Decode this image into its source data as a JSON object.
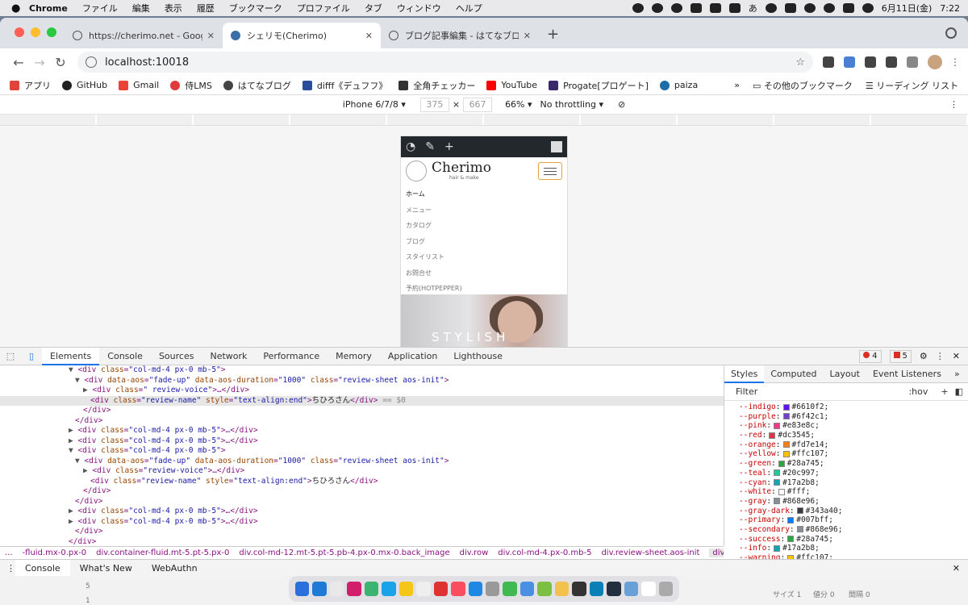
{
  "menubar": {
    "app": "Chrome",
    "items": [
      "ファイル",
      "編集",
      "表示",
      "履歴",
      "ブックマーク",
      "プロファイル",
      "タブ",
      "ウィンドウ",
      "ヘルプ"
    ],
    "date": "6月11日(金)",
    "time": "7:22",
    "ime": "あ"
  },
  "tabs": [
    {
      "title": "https://cherimo.net - Google 検索"
    },
    {
      "title": "シェリモ(Cherimo)"
    },
    {
      "title": "ブログ記事編集 - はてなブログ"
    }
  ],
  "url": "localhost:10018",
  "bookmarks": [
    {
      "label": "アプリ",
      "color": "#e0443b"
    },
    {
      "label": "GitHub",
      "color": "#222"
    },
    {
      "label": "Gmail",
      "color": "#ea4335"
    },
    {
      "label": "侍LMS",
      "color": "#e03a3a"
    },
    {
      "label": "はてなブログ",
      "color": "#444"
    },
    {
      "label": "difff《デュフフ》",
      "color": "#2a4d9b"
    },
    {
      "label": "全角チェッカー",
      "color": "#333"
    },
    {
      "label": "YouTube",
      "color": "#ff0000"
    },
    {
      "label": "Progate[プロゲート]",
      "color": "#3b2a6b"
    },
    {
      "label": "paiza",
      "color": "#1b6ea8"
    }
  ],
  "bookmarks_right": {
    "more": "»",
    "other": "その他のブックマーク",
    "reading": "リーディング リスト"
  },
  "device": {
    "name": "iPhone 6/7/8 ▾",
    "width": "375",
    "height": "667",
    "zoom": "66% ▾",
    "throttle": "No throttling ▾"
  },
  "site": {
    "name": "Cherimo",
    "sub": "hair & make",
    "nav": [
      "ホーム",
      "メニュー",
      "カタログ",
      "ブログ",
      "スタイリスト",
      "お問合せ",
      "予約(HOTPEPPER)"
    ],
    "hero": "STYLISH"
  },
  "devtools": {
    "tabs": [
      "Elements",
      "Console",
      "Sources",
      "Network",
      "Performance",
      "Memory",
      "Application",
      "Lighthouse"
    ],
    "errors": "4",
    "warnings": "5"
  },
  "dom": [
    {
      "indent": 85,
      "tri": "▼",
      "a": "<div ",
      "attrs": [
        [
          "class",
          "\"col-md-4 px-0 mb-5\""
        ]
      ],
      "b": ">"
    },
    {
      "indent": 93,
      "tri": "▼",
      "a": "<div ",
      "attrs": [
        [
          "data-aos",
          "\"fade-up\""
        ],
        [
          "data-aos-duration",
          "\"1000\""
        ],
        [
          "class",
          "\"review-sheet aos-init\""
        ]
      ],
      "b": ">"
    },
    {
      "indent": 103,
      "tri": "▶",
      "a": "<div ",
      "attrs": [
        [
          "class",
          "\" review-voice\""
        ]
      ],
      "b": ">…</div>"
    },
    {
      "indent": 112,
      "tri": "",
      "a": "<div ",
      "attrs": [
        [
          "class",
          "\"review-name\""
        ],
        [
          "style",
          "\"text-align:end\""
        ]
      ],
      "b": ">",
      "text": "ちひろさん",
      "c": "</div>",
      "suffix": " == $0",
      "sel": true
    },
    {
      "indent": 103,
      "tri": "",
      "a": "</div>",
      "attrs": [],
      "b": ""
    },
    {
      "indent": 93,
      "tri": "",
      "a": "</div>",
      "attrs": [],
      "b": ""
    },
    {
      "indent": 85,
      "tri": "▶",
      "a": "<div ",
      "attrs": [
        [
          "class",
          "\"col-md-4  px-0 mb-5\""
        ]
      ],
      "b": ">…</div>"
    },
    {
      "indent": 85,
      "tri": "▶",
      "a": "<div ",
      "attrs": [
        [
          "class",
          "\"col-md-4 px-0 mb-5\""
        ]
      ],
      "b": ">…</div>"
    },
    {
      "indent": 85,
      "tri": "▼",
      "a": "<div ",
      "attrs": [
        [
          "class",
          "\"col-md-4  px-0 mb-5\""
        ]
      ],
      "b": ">"
    },
    {
      "indent": 93,
      "tri": "▼",
      "a": "<div ",
      "attrs": [
        [
          "data-aos",
          "\"fade-up\""
        ],
        [
          "data-aos-duration",
          "\"1000\""
        ],
        [
          "class",
          "\"review-sheet aos-init\""
        ]
      ],
      "b": ">"
    },
    {
      "indent": 103,
      "tri": "▶",
      "a": "<div ",
      "attrs": [
        [
          "class",
          "\"review-voice\""
        ]
      ],
      "b": ">…</div>"
    },
    {
      "indent": 112,
      "tri": "",
      "a": "<div ",
      "attrs": [
        [
          "class",
          "\"review-name\""
        ],
        [
          "style",
          "\"text-align:end\""
        ]
      ],
      "b": ">",
      "text": "ちひろさん",
      "c": "</div>"
    },
    {
      "indent": 103,
      "tri": "",
      "a": "</div>",
      "attrs": [],
      "b": ""
    },
    {
      "indent": 93,
      "tri": "",
      "a": "</div>",
      "attrs": [],
      "b": ""
    },
    {
      "indent": 85,
      "tri": "▶",
      "a": "<div ",
      "attrs": [
        [
          "class",
          "\"col-md-4  px-0 mb-5\""
        ]
      ],
      "b": ">…</div>"
    },
    {
      "indent": 85,
      "tri": "▶",
      "a": "<div ",
      "attrs": [
        [
          "class",
          "\"col-md-4 px-0  mb-5\""
        ]
      ],
      "b": ">…</div>"
    },
    {
      "indent": 93,
      "tri": "",
      "a": "</div>",
      "attrs": [],
      "b": ""
    },
    {
      "indent": 85,
      "tri": "",
      "a": "</div>",
      "attrs": [],
      "b": ""
    }
  ],
  "styles": {
    "tabs": [
      "Styles",
      "Computed",
      "Layout",
      "Event Listeners",
      "»"
    ],
    "filter": "Filter",
    "hov": ":hov",
    ".cls": ".cls",
    "vars": [
      [
        "--indigo",
        "#6610f2"
      ],
      [
        "--purple",
        "#6f42c1"
      ],
      [
        "--pink",
        "#e83e8c"
      ],
      [
        "--red",
        "#dc3545"
      ],
      [
        "--orange",
        "#fd7e14"
      ],
      [
        "--yellow",
        "#ffc107"
      ],
      [
        "--green",
        "#28a745"
      ],
      [
        "--teal",
        "#20c997"
      ],
      [
        "--cyan",
        "#17a2b8"
      ],
      [
        "--white",
        "#fff"
      ],
      [
        "--gray",
        "#868e96"
      ],
      [
        "--gray-dark",
        "#343a40"
      ],
      [
        "--primary",
        "#007bff"
      ],
      [
        "--secondary",
        "#868e96"
      ],
      [
        "--success",
        "#28a745"
      ],
      [
        "--info",
        "#17a2b8"
      ],
      [
        "--warning",
        "#ffc107"
      ]
    ]
  },
  "breadcrumbs": [
    "...",
    "-fluid.mx-0.px-0",
    "div.container-fluid.mt-5.pt-5.px-0",
    "div.col-md-12.mt-5.pt-5.pb-4.px-0.mx-0.back_image",
    "div.row",
    "div.col-md-4.px-0.mb-5",
    "div.review-sheet.aos-init",
    "div.review-name",
    "..."
  ],
  "drawer": {
    "tabs": [
      "Console",
      "What's New",
      "WebAuthn"
    ]
  },
  "background": {
    "rows": [
      "5",
      "1"
    ],
    "right": [
      "サイズ 1",
      "値分 0",
      "間隔 0"
    ]
  },
  "dock": [
    "#2a6fdb",
    "#1f7ad6",
    "#e8e8e8",
    "#d21f6b",
    "#3cb371",
    "#1aa3e8",
    "#f5c518",
    "#eee",
    "#d33",
    "#fa4d5e",
    "#1e88e5",
    "#999",
    "#3fb950",
    "#4a90e2",
    "#7cc043",
    "#f2c14e",
    "#333",
    "#0a7fb5",
    "#232f3e",
    "#6aa0d9",
    "#fff",
    "#aaa"
  ]
}
